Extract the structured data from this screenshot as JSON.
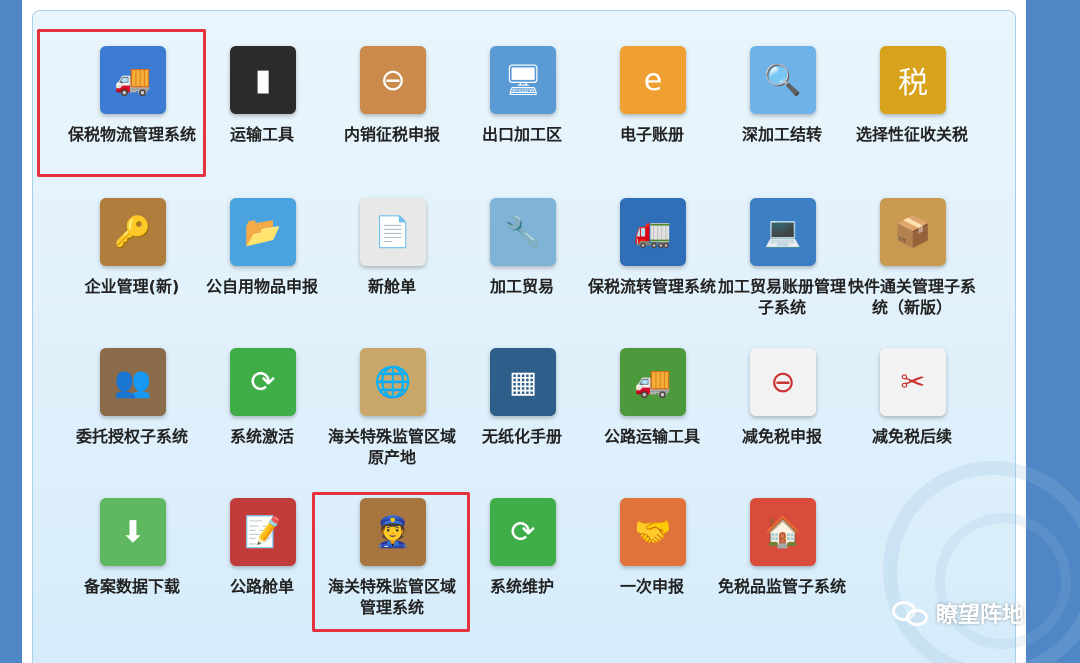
{
  "colors": {
    "highlight": "#e5323e",
    "frame": "#4f86c6",
    "panel": "#e3f2fb"
  },
  "tiles": [
    {
      "label": "保税物流管理系统",
      "icon": "truck-boxes-icon",
      "color": "#3b7bd3",
      "glyph": "🚚"
    },
    {
      "label": "运输工具",
      "icon": "shipping-container-icon",
      "color": "#2b2b2b",
      "glyph": "▮"
    },
    {
      "label": "内销征税申报",
      "icon": "crate-minus-icon",
      "color": "#c98a4b",
      "glyph": "⊖"
    },
    {
      "label": "出口加工区",
      "icon": "monitor-icon",
      "color": "#5b9bd5",
      "glyph": "🖥"
    },
    {
      "label": "电子账册",
      "icon": "e-mail-icon",
      "color": "#f0a030",
      "glyph": "e"
    },
    {
      "label": "深加工结转",
      "icon": "magnifier-icon",
      "color": "#6fb2e8",
      "glyph": "🔍"
    },
    {
      "label": "选择性征收关税",
      "icon": "tax-coins-icon",
      "color": "#d9a21b",
      "glyph": "税"
    },
    {
      "label": "企业管理(新)",
      "icon": "books-key-icon",
      "color": "#b07d3c",
      "glyph": "🔑"
    },
    {
      "label": "公自用物品申报",
      "icon": "folder-box-icon",
      "color": "#4aa3df",
      "glyph": "📂"
    },
    {
      "label": "新舱单",
      "icon": "document-icon",
      "color": "#e8e8e8",
      "glyph": "📄"
    },
    {
      "label": "加工贸易",
      "icon": "tools-icon",
      "color": "#7fb3d8",
      "glyph": "🔧"
    },
    {
      "label": "保税流转管理系统",
      "icon": "truck-cycle-icon",
      "color": "#2f6fb7",
      "glyph": "🚛"
    },
    {
      "label": "加工贸易账册管理子系统",
      "icon": "network-computer-icon",
      "color": "#3c7fc4",
      "glyph": "💻"
    },
    {
      "label": "快件通关管理子系统（新版）",
      "icon": "open-box-icon",
      "color": "#c89a52",
      "glyph": "📦"
    },
    {
      "label": "委托授权子系统",
      "icon": "users-icon",
      "color": "#8a6b4a",
      "glyph": "👥"
    },
    {
      "label": "系统激活",
      "icon": "refresh-icon",
      "color": "#3fae49",
      "glyph": "⟳"
    },
    {
      "label": "海关特殊监管区域原产地",
      "icon": "psao-globe-icon",
      "color": "#c9a76b",
      "glyph": "🌐"
    },
    {
      "label": "无纸化手册",
      "icon": "chip-icon",
      "color": "#2e5f8a",
      "glyph": "▦"
    },
    {
      "label": "公路运输工具",
      "icon": "truck-icon",
      "color": "#4d9a3c",
      "glyph": "🚚"
    },
    {
      "label": "减免税申报",
      "icon": "page-minus-icon",
      "color": "#f2f2f2",
      "glyph": "⊖"
    },
    {
      "label": "减免税后续",
      "icon": "scissors-icon",
      "color": "#f2f2f2",
      "glyph": "✂"
    },
    {
      "label": "备案数据下载",
      "icon": "download-icon",
      "color": "#5fb85f",
      "glyph": "⬇"
    },
    {
      "label": "公路舱单",
      "icon": "truck-document-icon",
      "color": "#c23b3b",
      "glyph": "📝"
    },
    {
      "label": "海关特殊监管区域管理系统",
      "icon": "customs-officers-icon",
      "color": "#a7753f",
      "glyph": "👮"
    },
    {
      "label": "系统维护",
      "icon": "refresh-icon",
      "color": "#3fae49",
      "glyph": "⟳"
    },
    {
      "label": "一次申报",
      "icon": "handshake-icon",
      "color": "#e0733a",
      "glyph": "🤝"
    },
    {
      "label": "免税品监管子系统",
      "icon": "house-ribbon-icon",
      "color": "#d94b3b",
      "glyph": "🏠"
    }
  ],
  "watermark": {
    "text": "瞭望阵地",
    "icon": "wechat-icon"
  }
}
